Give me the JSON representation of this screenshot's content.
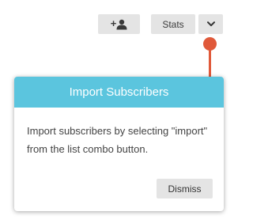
{
  "toolbar": {
    "add_subscriber_icon": "add-user-icon",
    "stats_label": "Stats",
    "combo_toggle_icon": "chevron-down-icon"
  },
  "tour": {
    "title": "Import Subscribers",
    "message": "Import subscribers by selecting \"import\" from the list combo button.",
    "dismiss_label": "Dismiss",
    "accent_color": "#5bc5de",
    "pointer_color": "#e0593a"
  }
}
